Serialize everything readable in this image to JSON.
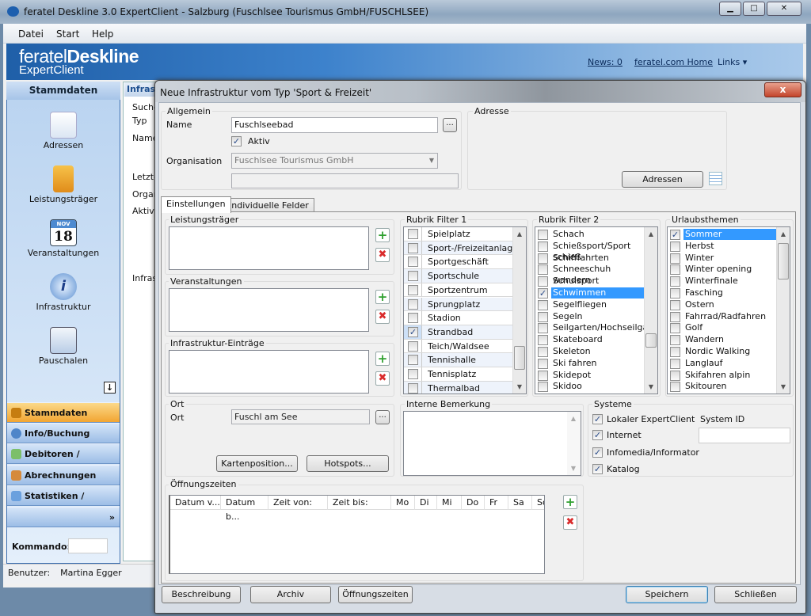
{
  "window": {
    "title": "feratel Deskline 3.0 ExpertClient - Salzburg (Fuschlsee Tourismus GmbH/FUSCHLSEE)",
    "controls": [
      "minimize",
      "maximize",
      "close"
    ]
  },
  "menu": [
    "Datei",
    "Start",
    "Help"
  ],
  "banner": {
    "logo_light": "feratel",
    "logo_bold": "Deskline",
    "logo_sub": "ExpertClient",
    "links": [
      "News: 0",
      "feratel.com Home",
      "Links"
    ]
  },
  "sidebar": {
    "header": "Stammdaten",
    "items": [
      {
        "label": "Adressen",
        "icon": "address-card-icon"
      },
      {
        "label": "Leistungsträger",
        "icon": "hotel-icon"
      },
      {
        "label": "Veranstaltungen",
        "icon": "calendar-icon",
        "calendar_day": "18",
        "calendar_month": "NOV"
      },
      {
        "label": "Infrastruktur",
        "icon": "info-pencil-icon"
      },
      {
        "label": "Pauschalen",
        "icon": "package-icon"
      }
    ],
    "nav": [
      {
        "label": "Stammdaten",
        "active": true
      },
      {
        "label": "Info/Buchung"
      },
      {
        "label": "Debitoren / Kreditor..."
      },
      {
        "label": "Abrechnungen"
      },
      {
        "label": "Statistiken / Reports"
      }
    ],
    "kommando_label": "Kommando:",
    "kommando_value": ""
  },
  "background": {
    "tab": "Infras",
    "labels": [
      "Suche",
      "Typ",
      "Name",
      "Letzte",
      "Organ",
      "Aktive",
      "Infras"
    ]
  },
  "status": {
    "user_label": "Benutzer:",
    "user": "Martina Egger"
  },
  "dialog": {
    "title": "Neue Infrastruktur vom Typ 'Sport & Freizeit'",
    "close": "x",
    "allgemein": {
      "title": "Allgemein",
      "name_label": "Name",
      "name_value": "Fuschlseebad",
      "aktiv_label": "Aktiv",
      "aktiv": true,
      "org_label": "Organisation",
      "org_value": "Fuschlsee Tourismus GmbH",
      "extra_value": "",
      "dots": "..."
    },
    "adresse": {
      "title": "Adresse",
      "button": "Adressen"
    },
    "tabs": [
      "Einstellungen",
      "Individuelle Felder"
    ],
    "leistungstraeger": "Leistungsträger",
    "veranstaltungen": "Veranstaltungen",
    "infra_eintraege": "Infrastruktur-Einträge",
    "rubrik1": {
      "title": "Rubrik Filter 1",
      "items": [
        {
          "t": "Spielplatz"
        },
        {
          "t": "Sport-/Freizeitanlage"
        },
        {
          "t": "Sportgeschäft"
        },
        {
          "t": "Sportschule"
        },
        {
          "t": "Sportzentrum"
        },
        {
          "t": "Sprungplatz"
        },
        {
          "t": "Stadion"
        },
        {
          "t": "Strandbad",
          "checked": true
        },
        {
          "t": "Teich/Waldsee"
        },
        {
          "t": "Tennishalle"
        },
        {
          "t": "Tennisplatz"
        },
        {
          "t": "Thermalbad"
        }
      ]
    },
    "rubrik2": {
      "title": "Rubrik Filter 2",
      "items": [
        {
          "t": "Schach"
        },
        {
          "t": "Schießsport/Sport schieß"
        },
        {
          "t": "Schifffahrten"
        },
        {
          "t": "Schneeschuh wandern"
        },
        {
          "t": "Schulsport"
        },
        {
          "t": "Schwimmen",
          "checked": true
        },
        {
          "t": "Segelfliegen"
        },
        {
          "t": "Segeln"
        },
        {
          "t": "Seilgarten/Hochseilgarten"
        },
        {
          "t": "Skateboard"
        },
        {
          "t": "Skeleton"
        },
        {
          "t": "Ski fahren"
        },
        {
          "t": "Skidepot"
        },
        {
          "t": "Skidoo"
        }
      ]
    },
    "urlaub": {
      "title": "Urlaubsthemen",
      "items": [
        {
          "t": "Sommer",
          "checked": true
        },
        {
          "t": "Herbst"
        },
        {
          "t": "Winter"
        },
        {
          "t": "Winter opening"
        },
        {
          "t": "Winterfinale"
        },
        {
          "t": "Fasching"
        },
        {
          "t": "Ostern"
        },
        {
          "t": "Fahrrad/Radfahren"
        },
        {
          "t": "Golf"
        },
        {
          "t": "Wandern"
        },
        {
          "t": "Nordic Walking"
        },
        {
          "t": "Langlauf"
        },
        {
          "t": "Skifahren alpin"
        },
        {
          "t": "Skitouren"
        }
      ]
    },
    "ort": {
      "title": "Ort",
      "label": "Ort",
      "value": "Fuschl am See",
      "karten": "Kartenposition...",
      "hotspots": "Hotspots..."
    },
    "bemerkung": {
      "title": "Interne Bemerkung",
      "value": ""
    },
    "systeme": {
      "title": "Systeme",
      "items": [
        {
          "t": "Lokaler ExpertClient",
          "checked": true
        },
        {
          "t": "Internet",
          "checked": true
        },
        {
          "t": "Infomedia/Informator",
          "checked": true
        },
        {
          "t": "Katalog",
          "checked": true
        }
      ],
      "sysid_label": "System ID",
      "sysid_value": ""
    },
    "oeffnung": {
      "title": "Öffnungszeiten",
      "columns": [
        "Datum v...",
        "Datum b...",
        "Zeit von:",
        "Zeit bis:",
        "Mo",
        "Di",
        "Mi",
        "Do",
        "Fr",
        "Sa",
        "So"
      ]
    },
    "buttons": {
      "beschreibung": "Beschreibung",
      "archiv": "Archiv",
      "oeffnungszeiten": "Öffnungszeiten",
      "speichern": "Speichern",
      "schliessen": "Schließen"
    }
  },
  "colors": {
    "accent": "#3399ff",
    "nav_active": "#f2a531",
    "banner": "#1f5fa8"
  }
}
